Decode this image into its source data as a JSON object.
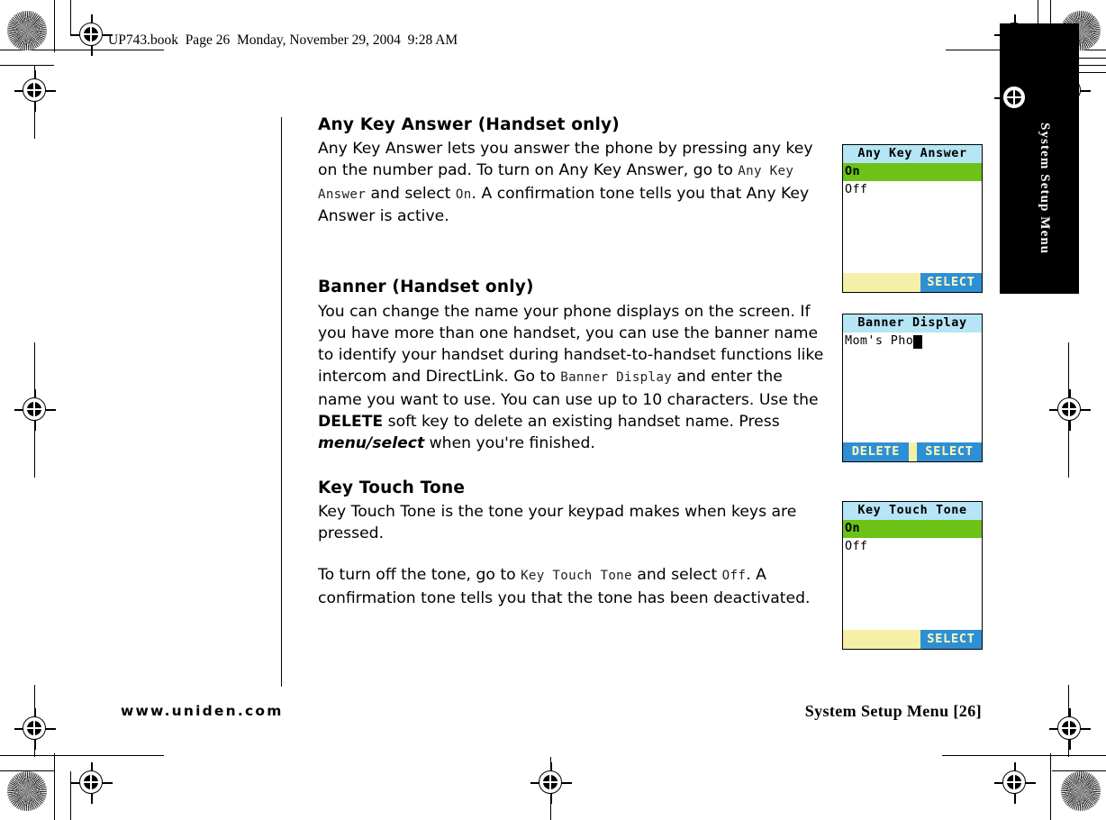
{
  "page": {
    "file_header": "UP743.book  Page 26  Monday, November 29, 2004  9:28 AM",
    "side_tab_label": "System Setup Menu",
    "footer_left": "www.uniden.com",
    "footer_right": "System Setup Menu [26]"
  },
  "sections": [
    {
      "heading": "Any Key Answer (Handset only)",
      "body_parts": [
        {
          "type": "text",
          "text": "Any Key Answer lets you answer the phone by pressing any key on the number pad. To turn on Any Key Answer, go to "
        },
        {
          "type": "ui",
          "text": "Any Key Answer"
        },
        {
          "type": "text",
          "text": " and select "
        },
        {
          "type": "ui",
          "text": "On"
        },
        {
          "type": "text",
          "text": ". A confirmation tone tells you that Any Key Answer is active."
        }
      ]
    },
    {
      "heading": "Banner (Handset only)",
      "body_parts": [
        {
          "type": "text",
          "text": "You can change the name your phone displays on the screen. If you have more than one handset, you can use the banner name to identify your handset during handset-to-handset functions like intercom and DirectLink. Go to "
        },
        {
          "type": "ui",
          "text": "Banner Display"
        },
        {
          "type": "text",
          "text": " and enter the name you want to use. You can use up to 10 characters. Use the "
        },
        {
          "type": "bold",
          "text": "DELETE"
        },
        {
          "type": "text",
          "text": " soft key to delete an existing handset name. Press "
        },
        {
          "type": "bolditalic",
          "text": "menu/select"
        },
        {
          "type": "text",
          "text": " when you're finished."
        }
      ]
    },
    {
      "heading": "Key Touch Tone",
      "body_parts": [
        {
          "type": "text",
          "text": "Key Touch Tone is the tone your keypad makes when keys are pressed."
        }
      ],
      "body_parts2": [
        {
          "type": "text",
          "text": "To turn off the tone, go to "
        },
        {
          "type": "ui",
          "text": "Key Touch Tone"
        },
        {
          "type": "text",
          "text": " and select "
        },
        {
          "type": "ui",
          "text": "Off"
        },
        {
          "type": "text",
          "text": ". A confirmation tone tells you that the tone has been deactivated."
        }
      ]
    }
  ],
  "lcd_screens": [
    {
      "title": "Any Key Answer",
      "type": "list",
      "rows": [
        {
          "label": "On",
          "selected": true
        },
        {
          "label": "Off",
          "selected": false
        }
      ],
      "softkeys": [
        {
          "label": "",
          "style": "yellow"
        },
        {
          "label": "SELECT",
          "style": "blue"
        }
      ]
    },
    {
      "title": "Banner Display",
      "type": "input",
      "input_value": "Mom's Pho",
      "cursor": true,
      "softkeys": [
        {
          "label": "DELETE",
          "style": "blue"
        },
        {
          "label": "",
          "style": "yellow-divider"
        },
        {
          "label": "SELECT",
          "style": "blue"
        }
      ]
    },
    {
      "title": "Key Touch Tone",
      "type": "list",
      "rows": [
        {
          "label": "On",
          "selected": true
        },
        {
          "label": "Off",
          "selected": false
        }
      ],
      "softkeys": [
        {
          "label": "",
          "style": "yellow"
        },
        {
          "label": "SELECT",
          "style": "blue"
        }
      ]
    }
  ],
  "colors": {
    "lcd_title_bg": "#b6e5f5",
    "lcd_selected_row_bg": "#6cc217",
    "softkey_blue": "#2f8fd4",
    "softkey_yellow": "#f5f0a8",
    "softkey_text": "#f4f4bb",
    "tab_bg": "#000000",
    "page_bg": "#ffffff"
  }
}
